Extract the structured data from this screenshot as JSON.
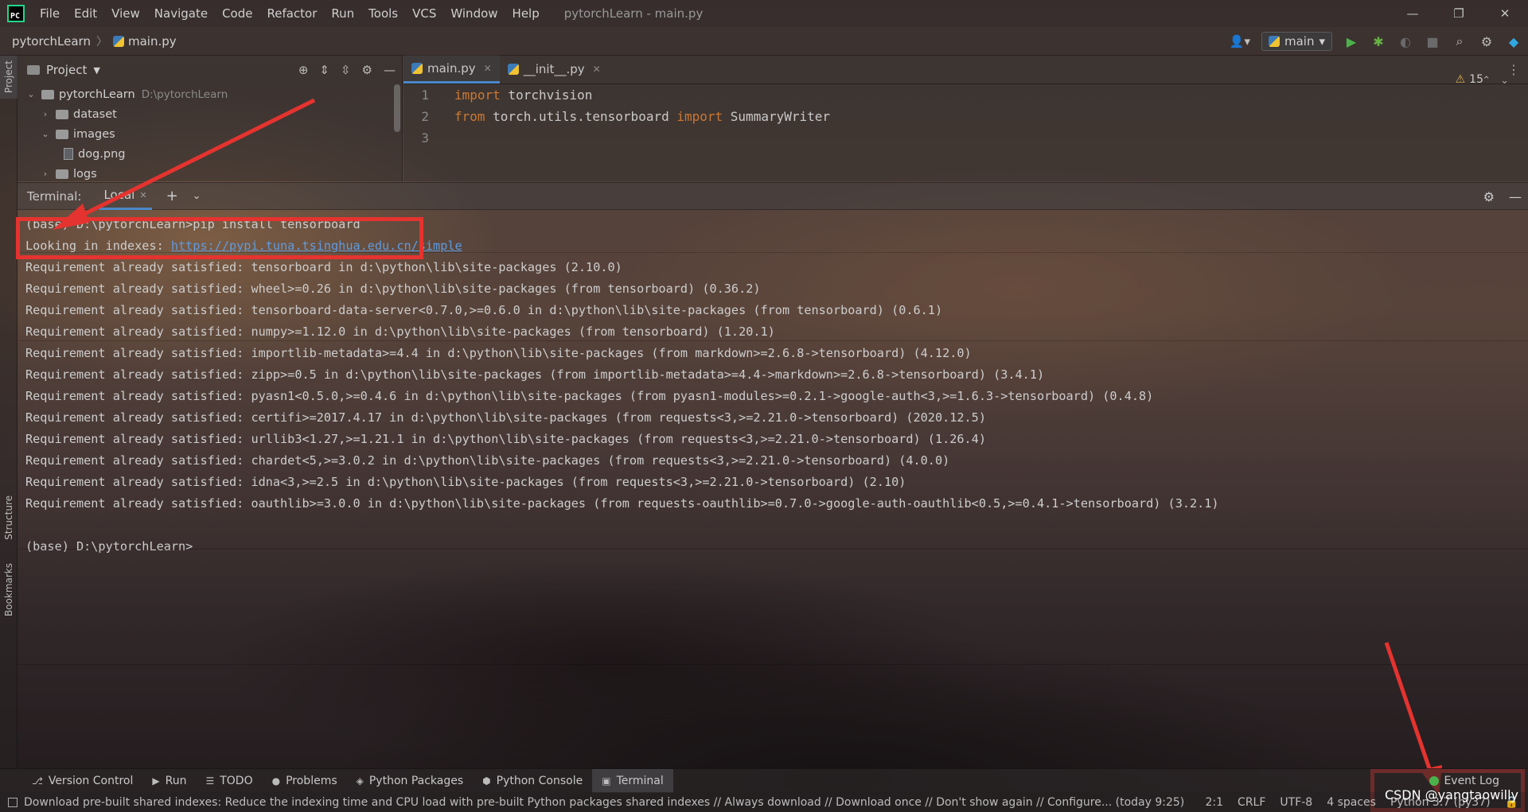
{
  "window": {
    "app_logo": "PC",
    "title": "pytorchLearn - main.py",
    "menu": [
      "File",
      "Edit",
      "View",
      "Navigate",
      "Code",
      "Refactor",
      "Run",
      "Tools",
      "VCS",
      "Window",
      "Help"
    ],
    "controls": [
      "—",
      "❐",
      "✕"
    ]
  },
  "navbar": {
    "project": "pytorchLearn",
    "file": "main.py",
    "run_config": "main"
  },
  "left_stripe": {
    "tabs": [
      "Project",
      "Structure",
      "Bookmarks"
    ]
  },
  "project_panel": {
    "title": "Project",
    "tree": [
      {
        "name": "pytorchLearn",
        "path": "D:\\pytorchLearn",
        "type": "folder",
        "expanded": true,
        "depth": 0
      },
      {
        "name": "dataset",
        "type": "folder",
        "expanded": false,
        "depth": 1
      },
      {
        "name": "images",
        "type": "folder",
        "expanded": true,
        "depth": 1
      },
      {
        "name": "dog.png",
        "type": "image",
        "depth": 2
      },
      {
        "name": "logs",
        "type": "folder",
        "expanded": false,
        "depth": 1
      }
    ]
  },
  "editor": {
    "tabs": [
      {
        "label": "main.py",
        "active": true
      },
      {
        "label": "__init__.py",
        "active": false
      }
    ],
    "lines": [
      {
        "no": "1",
        "kw": "import",
        "rest": " torchvision"
      },
      {
        "no": "2",
        "kw": "from",
        "rest": " torch.utils.tensorboard ",
        "kw2": "import",
        "rest2": " SummaryWriter"
      },
      {
        "no": "3",
        "kw": "",
        "rest": ""
      }
    ],
    "warnings_count": "15"
  },
  "terminal": {
    "label": "Terminal:",
    "tab": "Local",
    "lines": [
      {
        "text": "(base) D:\\pytorchLearn>pip install tensorboard"
      },
      {
        "text": "Looking in indexes: ",
        "link": "https://pypi.tuna.tsinghua.edu.cn/simple"
      },
      {
        "text": "Requirement already satisfied: tensorboard in d:\\python\\lib\\site-packages (2.10.0)"
      },
      {
        "text": "Requirement already satisfied: wheel>=0.26 in d:\\python\\lib\\site-packages (from tensorboard) (0.36.2)"
      },
      {
        "text": "Requirement already satisfied: tensorboard-data-server<0.7.0,>=0.6.0 in d:\\python\\lib\\site-packages (from tensorboard) (0.6.1)"
      },
      {
        "text": "Requirement already satisfied: numpy>=1.12.0 in d:\\python\\lib\\site-packages (from tensorboard) (1.20.1)"
      },
      {
        "text": "Requirement already satisfied: importlib-metadata>=4.4 in d:\\python\\lib\\site-packages (from markdown>=2.6.8->tensorboard) (4.12.0)"
      },
      {
        "text": "Requirement already satisfied: zipp>=0.5 in d:\\python\\lib\\site-packages (from importlib-metadata>=4.4->markdown>=2.6.8->tensorboard) (3.4.1)"
      },
      {
        "text": "Requirement already satisfied: pyasn1<0.5.0,>=0.4.6 in d:\\python\\lib\\site-packages (from pyasn1-modules>=0.2.1->google-auth<3,>=1.6.3->tensorboard) (0.4.8)"
      },
      {
        "text": "Requirement already satisfied: certifi>=2017.4.17 in d:\\python\\lib\\site-packages (from requests<3,>=2.21.0->tensorboard) (2020.12.5)"
      },
      {
        "text": "Requirement already satisfied: urllib3<1.27,>=1.21.1 in d:\\python\\lib\\site-packages (from requests<3,>=2.21.0->tensorboard) (1.26.4)"
      },
      {
        "text": "Requirement already satisfied: chardet<5,>=3.0.2 in d:\\python\\lib\\site-packages (from requests<3,>=2.21.0->tensorboard) (4.0.0)"
      },
      {
        "text": "Requirement already satisfied: idna<3,>=2.5 in d:\\python\\lib\\site-packages (from requests<3,>=2.21.0->tensorboard) (2.10)"
      },
      {
        "text": "Requirement already satisfied: oauthlib>=3.0.0 in d:\\python\\lib\\site-packages (from requests-oauthlib>=0.7.0->google-auth-oauthlib<0.5,>=0.4.1->tensorboard) (3.2.1)"
      },
      {
        "text": ""
      },
      {
        "text": "(base) D:\\pytorchLearn>"
      }
    ]
  },
  "bottom_tools": [
    {
      "label": "Version Control",
      "icon": "⎇"
    },
    {
      "label": "Run",
      "icon": "▶"
    },
    {
      "label": "TODO",
      "icon": "☰"
    },
    {
      "label": "Problems",
      "icon": "●"
    },
    {
      "label": "Python Packages",
      "icon": "◈"
    },
    {
      "label": "Python Console",
      "icon": "⬢"
    },
    {
      "label": "Terminal",
      "icon": "▣",
      "active": true
    }
  ],
  "event_log": "Event Log",
  "statusbar": {
    "message": "Download pre-built shared indexes: Reduce the indexing time and CPU load with pre-built Python packages shared indexes // Always download // Download once // Don't show again // Configure... (today 9:25)",
    "position": "2:1",
    "line_sep": "CRLF",
    "encoding": "UTF-8",
    "indent": "4 spaces",
    "interpreter": "Python 3.7 (py37)"
  },
  "watermark": "CSDN @yangtaowilly",
  "colors": {
    "annotation_red": "#e5332f",
    "keyword": "#cc7832",
    "link": "#5f9be0",
    "accent": "#4a88c7"
  }
}
